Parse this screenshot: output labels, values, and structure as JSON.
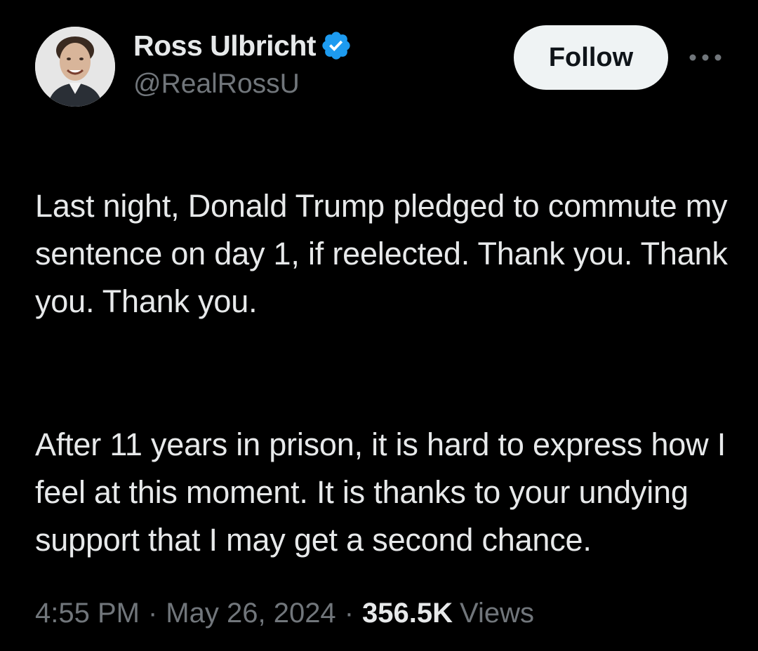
{
  "author": {
    "display_name": "Ross Ulbricht",
    "handle": "@RealRossU",
    "verified": true,
    "verified_color": "#1d9bf0",
    "avatar_icon": "profile-photo"
  },
  "actions": {
    "follow_label": "Follow",
    "more_icon": "more-horizontal-icon"
  },
  "tweet": {
    "paragraphs": [
      "Last night, Donald Trump pledged to commute my sentence on day 1, if reelected. Thank you. Thank you. Thank you.",
      "After 11 years in prison, it is hard to express how I feel at this moment. It is thanks to your undying support that I may get a second chance."
    ]
  },
  "meta": {
    "time": "4:55 PM",
    "date": "May 26, 2024",
    "separator": "·",
    "views_count": "356.5K",
    "views_label": "Views"
  },
  "colors": {
    "background": "#000000",
    "primary_text": "#e7e9ea",
    "secondary_text": "#71767b",
    "follow_button_bg": "#eff3f4",
    "follow_button_text": "#0f1419"
  }
}
